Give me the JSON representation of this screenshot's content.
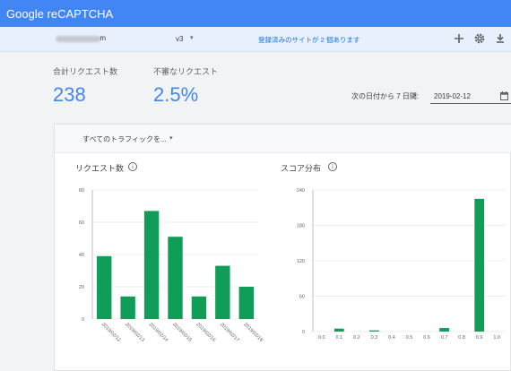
{
  "appbar": {
    "title": "Google reCAPTCHA"
  },
  "site": {
    "visible_suffix": "m",
    "version": "v3"
  },
  "notice": "登録済みのサイトが 2 個あります",
  "icons": {
    "add": "add-icon",
    "settings": "settings-icon",
    "download": "download-icon",
    "calendar": "calendar-icon",
    "info": "info-icon",
    "caret": "caret-down-icon"
  },
  "stats": [
    {
      "label": "合計リクエスト数",
      "value": "238"
    },
    {
      "label": "不審なリクエスト",
      "value": "2.5%"
    }
  ],
  "range": {
    "label": "次の日付から 7 日間:",
    "date": "2019-02-12"
  },
  "filter": {
    "label": "すべてのトラフィックを..."
  },
  "colors": {
    "accent": "#4285f4",
    "bar": "#0f9d58"
  },
  "chart_data": [
    {
      "type": "bar",
      "title": "リクエスト数",
      "categories": [
        "2019/02/12",
        "2019/02/13",
        "2019/02/14",
        "2019/02/15",
        "2019/02/16",
        "2019/02/17",
        "2019/02/18"
      ],
      "values": [
        39,
        14,
        67,
        51,
        14,
        33,
        20
      ],
      "ylim": [
        0,
        80
      ],
      "yticks": [
        "0",
        "20",
        "40",
        "60",
        "80"
      ],
      "grid": true
    },
    {
      "type": "bar",
      "title": "スコア分布",
      "categories": [
        "0.0",
        "0.1",
        "0.2",
        "0.3",
        "0.4",
        "0.5",
        "0.6",
        "0.7",
        "0.8",
        "0.9",
        "1.0"
      ],
      "values": [
        0,
        5,
        0,
        2,
        0,
        0,
        0,
        6,
        0,
        225,
        0
      ],
      "ylim": [
        0,
        240
      ],
      "yticks": [
        "0",
        "60",
        "120",
        "180",
        "240"
      ],
      "grid": true
    }
  ]
}
